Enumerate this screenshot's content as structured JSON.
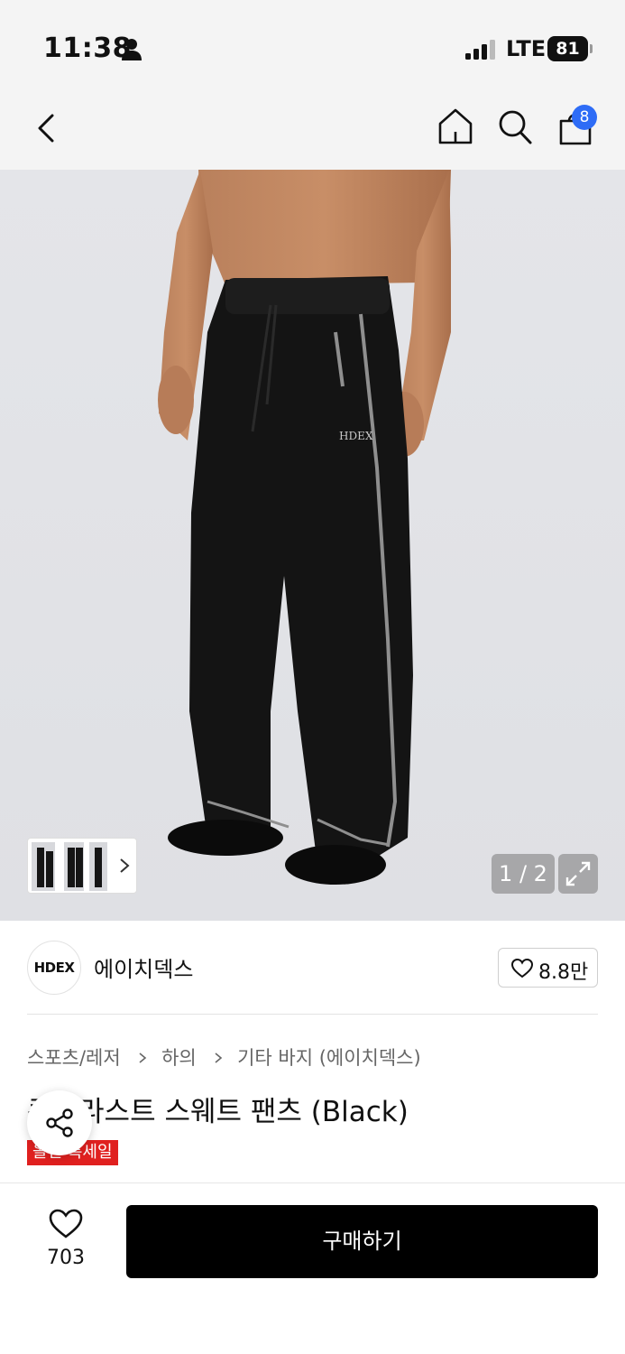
{
  "status_bar": {
    "time": "11:38",
    "network": "LTE",
    "battery": "81",
    "icons": [
      "person-icon",
      "signal-icon",
      "battery-icon"
    ]
  },
  "nav": {
    "icons": [
      "back-icon",
      "home-icon",
      "search-icon",
      "bag-icon"
    ],
    "cart_count": "8"
  },
  "gallery": {
    "counter": "1 / 2",
    "thumbnail_logo": "HDEX",
    "icons": [
      "chevron-right-icon",
      "expand-icon"
    ]
  },
  "brand": {
    "logo": "HDEX",
    "name": "에이치덱스",
    "likes": "8.8만"
  },
  "breadcrumb": {
    "items": [
      "스포츠/레저",
      "하의",
      "기타 바지 (에이치덱스)"
    ]
  },
  "product": {
    "title": "콘트라스트 스웨트 팬츠 (Black)",
    "badge": "올인 특세일",
    "badge_color": "#e0201f"
  },
  "bottom_bar": {
    "wish_count": "703",
    "buy_label": "구매하기"
  },
  "colors": {
    "accent_badge": "#2e6cf6",
    "buy_button": "#000000"
  }
}
